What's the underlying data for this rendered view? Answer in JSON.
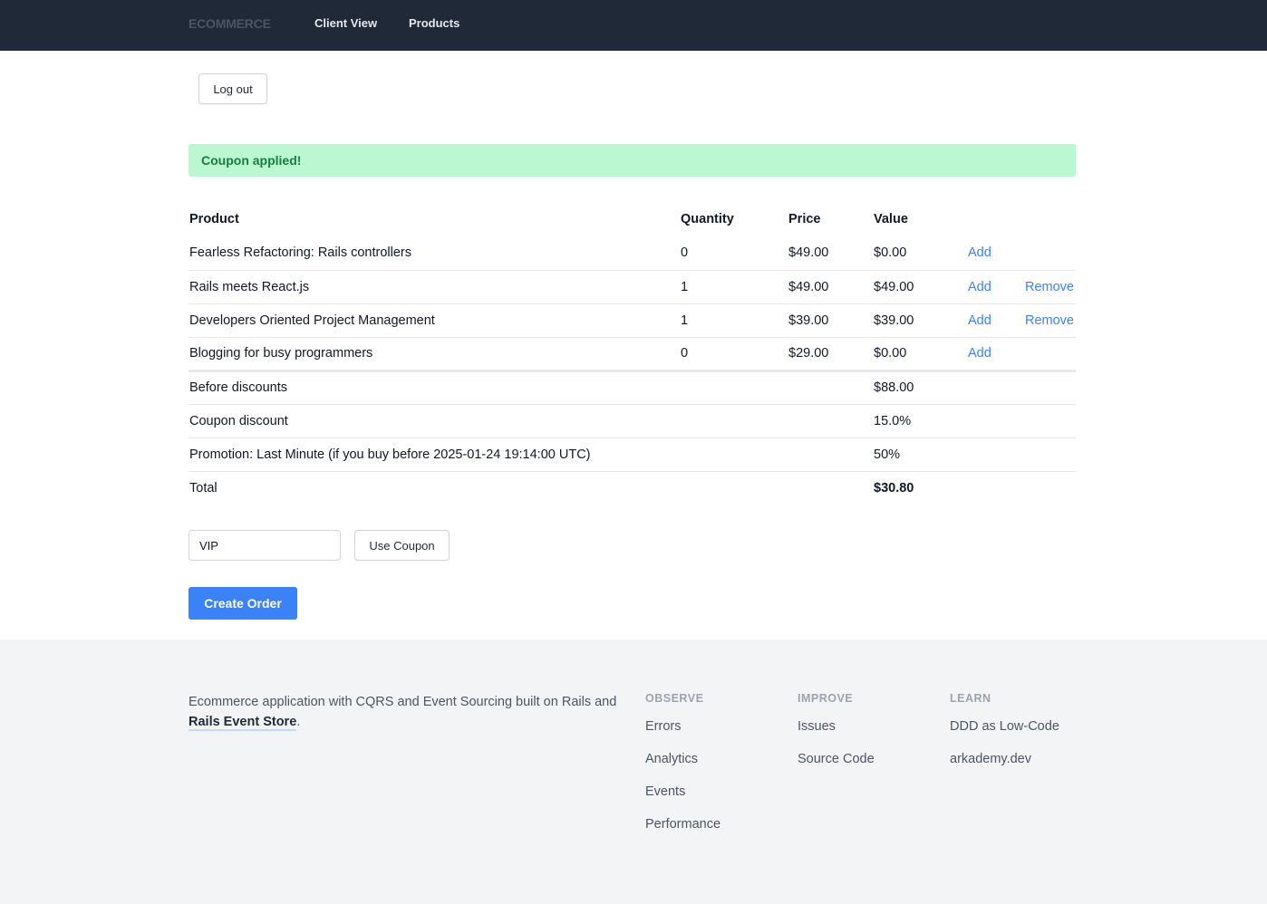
{
  "nav": {
    "brand": "ECOMMERCE",
    "links": [
      "Client View",
      "Products"
    ]
  },
  "logout_label": "Log out",
  "alert": {
    "text": "Coupon applied!"
  },
  "table": {
    "headers": [
      "Product",
      "Quantity",
      "Price",
      "Value"
    ],
    "rows": [
      {
        "product": "Fearless Refactoring: Rails controllers",
        "quantity": "0",
        "price": "$49.00",
        "value": "$0.00",
        "add": "Add",
        "remove": ""
      },
      {
        "product": "Rails meets React.js",
        "quantity": "1",
        "price": "$49.00",
        "value": "$49.00",
        "add": "Add",
        "remove": "Remove"
      },
      {
        "product": "Developers Oriented Project Management",
        "quantity": "1",
        "price": "$39.00",
        "value": "$39.00",
        "add": "Add",
        "remove": "Remove"
      },
      {
        "product": "Blogging for busy programmers",
        "quantity": "0",
        "price": "$29.00",
        "value": "$0.00",
        "add": "Add",
        "remove": ""
      }
    ],
    "summary": [
      {
        "label": "Before discounts",
        "value": "$88.00"
      },
      {
        "label": "Coupon discount",
        "value": "15.0%"
      },
      {
        "label": "Promotion: Last Minute (if you buy before 2025-01-24 19:14:00 UTC)",
        "value": "50%"
      },
      {
        "label": "Total",
        "value": "$30.80"
      }
    ]
  },
  "coupon": {
    "value": "VIP",
    "button_label": "Use Coupon"
  },
  "create_order_label": "Create Order",
  "footer": {
    "description_before": "Ecommerce application with CQRS and Event Sourcing built on Rails and ",
    "description_link": "Rails Event Store",
    "description_after": ".",
    "columns": [
      {
        "title": "OBSERVE",
        "links": [
          "Errors",
          "Analytics",
          "Events",
          "Performance"
        ]
      },
      {
        "title": "IMPROVE",
        "links": [
          "Issues",
          "Source Code"
        ]
      },
      {
        "title": "LEARN",
        "links": [
          "DDD as Low-Code",
          "arkademy.dev"
        ]
      }
    ]
  },
  "colors": {
    "nav_bg": "#1f2937",
    "accent": "#3b82f6",
    "alert_bg": "#bbf7d0",
    "alert_text": "#15803d",
    "footer_bg": "#f3f4f6"
  }
}
